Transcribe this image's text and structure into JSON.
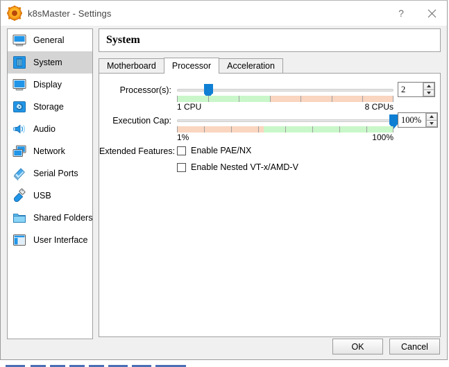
{
  "window": {
    "title": "k8sMaster - Settings",
    "icon": "virtualbox-gear-icon",
    "help_label": "?",
    "close_label": "✕"
  },
  "sidebar": {
    "items": [
      {
        "label": "General",
        "icon": "monitor-icon",
        "selected": false
      },
      {
        "label": "System",
        "icon": "motherboard-icon",
        "selected": true
      },
      {
        "label": "Display",
        "icon": "display-icon",
        "selected": false
      },
      {
        "label": "Storage",
        "icon": "harddisk-icon",
        "selected": false
      },
      {
        "label": "Audio",
        "icon": "speaker-icon",
        "selected": false
      },
      {
        "label": "Network",
        "icon": "network-cards-icon",
        "selected": false
      },
      {
        "label": "Serial Ports",
        "icon": "serial-port-icon",
        "selected": false
      },
      {
        "label": "USB",
        "icon": "usb-plug-icon",
        "selected": false
      },
      {
        "label": "Shared Folders",
        "icon": "folder-icon",
        "selected": false
      },
      {
        "label": "User Interface",
        "icon": "window-layout-icon",
        "selected": false
      }
    ]
  },
  "main": {
    "header_title": "System",
    "tabs": [
      {
        "label": "Motherboard",
        "active": false
      },
      {
        "label": "Processor",
        "active": true
      },
      {
        "label": "Acceleration",
        "active": false
      }
    ],
    "processors": {
      "label": "Processor(s):",
      "min_label": "1 CPU",
      "max_label": "8 CPUs",
      "value": "2",
      "handle_percent": 14.3,
      "green_percent": 43,
      "tick_count": 8
    },
    "execution_cap": {
      "label": "Execution Cap:",
      "min_label": "1%",
      "max_label": "100%",
      "value": "100%",
      "handle_percent": 100,
      "salmon_percent": 40,
      "tick_count": 9
    },
    "extended_features": {
      "label": "Extended Features:",
      "options": [
        {
          "label": "Enable PAE/NX",
          "checked": false
        },
        {
          "label": "Enable Nested VT-x/AMD-V",
          "checked": false
        }
      ]
    }
  },
  "footer": {
    "ok_label": "OK",
    "cancel_label": "Cancel"
  },
  "colors": {
    "slider_handle": "#0f7fd4",
    "zone_green": "#c9f7c9",
    "zone_salmon": "#fad5c0",
    "selection_gray": "#d4d4d4",
    "icon_blue": "#1e90d8"
  }
}
